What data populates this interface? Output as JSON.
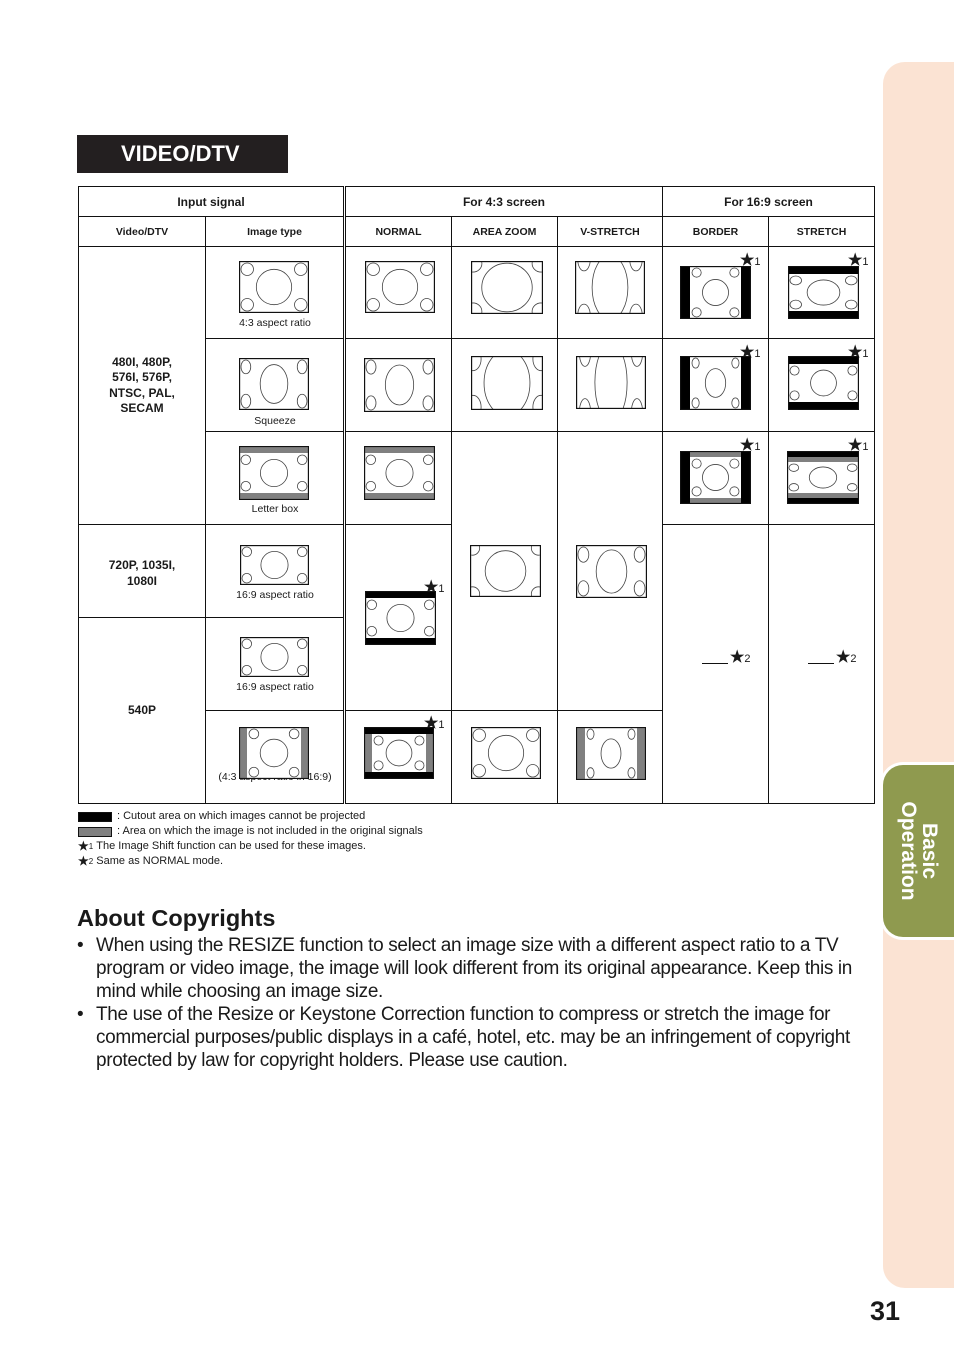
{
  "page": {
    "number": "31"
  },
  "side_tab": {
    "line1": "Basic",
    "line2": "Operation",
    "color": "#8f9a4f",
    "strip_color": "#fbe3d3"
  },
  "section": {
    "title": "VIDEO/DTV"
  },
  "table": {
    "group_headers": {
      "input_signal": "Input signal",
      "screen_43": "For 4:3 screen",
      "screen_169": "For 16:9 screen"
    },
    "column_headers": [
      "Video/DTV",
      "Image type",
      "NORMAL",
      "AREA ZOOM",
      "V-STRETCH",
      "BORDER",
      "STRETCH"
    ],
    "signals": [
      {
        "label": "480I, 480P, 576I, 576P, NTSC, PAL, SECAM"
      },
      {
        "label": "720P, 1035I, 1080I"
      },
      {
        "label": "540P"
      }
    ],
    "image_types": [
      "4:3 aspect ratio",
      "Squeeze",
      "Letter box",
      "16:9 aspect ratio",
      "16:9 aspect ratio",
      "(4:3 aspect ratio in 16:9)"
    ],
    "star1": "1",
    "star2": "2"
  },
  "legend": {
    "cutout": ": Cutout area on which images cannot be projected",
    "not_included": ": Area on which the image is not included in the original signals",
    "note1_mark": "1",
    "note1": "The Image Shift function can be used for these images.",
    "note2_mark": "2",
    "note2": "Same as NORMAL mode.",
    "cutout_color": "#000000",
    "not_included_color": "#808080"
  },
  "about": {
    "title": "About Copyrights",
    "bullets": [
      "When using the RESIZE function to select an image size with a different aspect ratio to a TV program or video image, the image will look different from its original appearance. Keep this in mind while choosing an image size.",
      "The use of the Resize or Keystone Correction function to compress or stretch the image for commercial purposes/public displays in a café, hotel, etc. may be an infringement of copyright protected by law for copyright holders. Please use caution."
    ]
  }
}
